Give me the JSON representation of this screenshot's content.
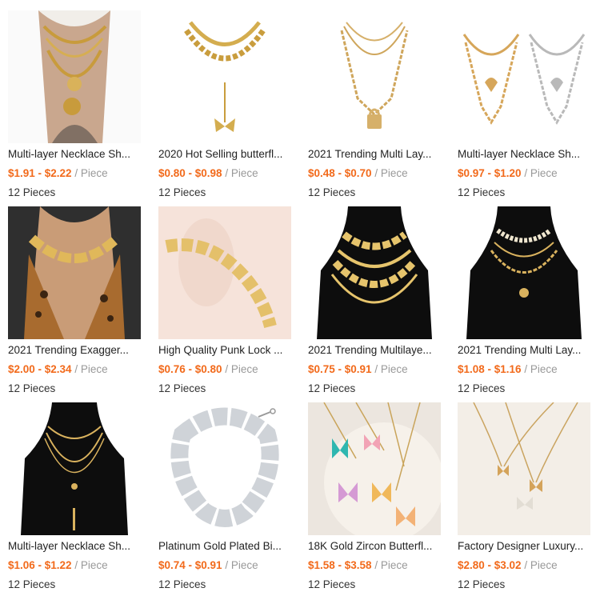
{
  "products": [
    {
      "title": "Multi-layer Necklace Sh...",
      "price": "$1.91 - $2.22",
      "unit": "/ Piece",
      "moq": "12 Pieces"
    },
    {
      "title": "2020 Hot Selling butterfl...",
      "price": "$0.80 - $0.98",
      "unit": "/ Piece",
      "moq": "12 Pieces"
    },
    {
      "title": "2021 Trending Multi Lay...",
      "price": "$0.48 - $0.70",
      "unit": "/ Piece",
      "moq": "12 Pieces"
    },
    {
      "title": "Multi-layer Necklace Sh...",
      "price": "$0.97 - $1.20",
      "unit": "/ Piece",
      "moq": "12 Pieces"
    },
    {
      "title": "2021 Trending Exagger...",
      "price": "$2.00 - $2.34",
      "unit": "/ Piece",
      "moq": "12 Pieces"
    },
    {
      "title": "High Quality Punk Lock ...",
      "price": "$0.76 - $0.80",
      "unit": "/ Piece",
      "moq": "12 Pieces"
    },
    {
      "title": "2021 Trending Multilaye...",
      "price": "$0.75 - $0.91",
      "unit": "/ Piece",
      "moq": "12 Pieces"
    },
    {
      "title": "2021 Trending Multi Lay...",
      "price": "$1.08 - $1.16",
      "unit": "/ Piece",
      "moq": "12 Pieces"
    },
    {
      "title": "Multi-layer Necklace Sh...",
      "price": "$1.06 - $1.22",
      "unit": "/ Piece",
      "moq": "12 Pieces"
    },
    {
      "title": "Platinum Gold Plated Bi...",
      "price": "$0.74 - $0.91",
      "unit": "/ Piece",
      "moq": "12 Pieces"
    },
    {
      "title": "18K Gold Zircon Butterfl...",
      "price": "$1.58 - $3.58",
      "unit": "/ Piece",
      "moq": "12 Pieces"
    },
    {
      "title": "Factory Designer Luxury...",
      "price": "$2.80 - $3.02",
      "unit": "/ Piece",
      "moq": "12 Pieces"
    }
  ],
  "colors": {
    "price": "#f26a1b",
    "unit": "#999999",
    "text": "#222222"
  }
}
